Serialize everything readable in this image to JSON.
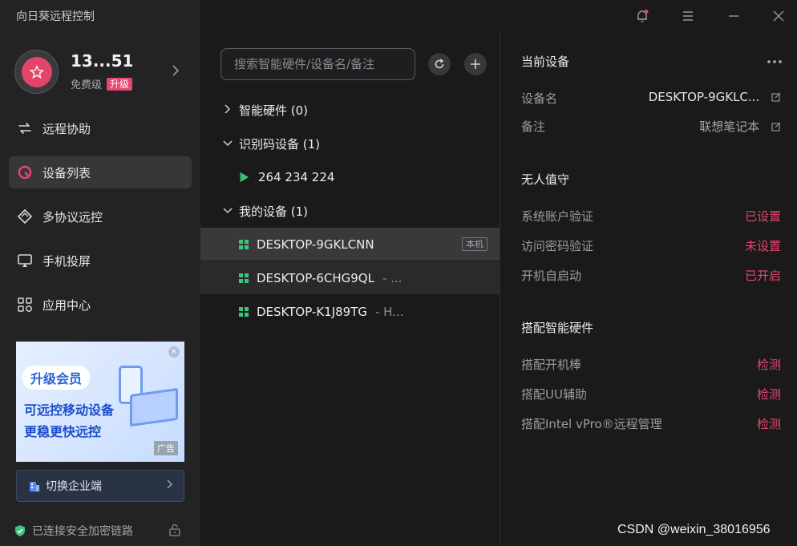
{
  "app": {
    "title": "向日葵远程控制"
  },
  "user": {
    "name": "13...51",
    "level": "免费级",
    "upgrade_label": "升级"
  },
  "nav": [
    {
      "label": "远程协助",
      "icon": "remote-assist-icon"
    },
    {
      "label": "设备列表",
      "icon": "device-list-icon",
      "active": true
    },
    {
      "label": "多协议远控",
      "icon": "multi-protocol-icon"
    },
    {
      "label": "手机投屏",
      "icon": "screen-cast-icon"
    },
    {
      "label": "应用中心",
      "icon": "app-center-icon"
    }
  ],
  "ad": {
    "pill": "升级会员",
    "line1": "可远控移动设备",
    "line2": "更稳更快远控",
    "tag": "广告"
  },
  "switch_button": {
    "label": "切换企业端"
  },
  "secure_status": "已连接安全加密链路",
  "search": {
    "placeholder": "搜索智能硬件/设备名/备注"
  },
  "groups": [
    {
      "label": "智能硬件 (0)",
      "expanded": false
    },
    {
      "label": "识别码设备 (1)",
      "expanded": true
    },
    {
      "label": "我的设备 (1)",
      "expanded": true
    }
  ],
  "code_device": {
    "code": "264 234 224"
  },
  "devices": [
    {
      "name": "DESKTOP-9GKLCNN",
      "note": "",
      "tag": "本机",
      "selected": true
    },
    {
      "name": "DESKTOP-6CHG9QL",
      "note": "- ...",
      "tag": ""
    },
    {
      "name": "DESKTOP-K1J89TG",
      "note": "- H...",
      "tag": ""
    }
  ],
  "current_device": {
    "title": "当前设备",
    "name_label": "设备名",
    "name_value": "DESKTOP-9GKLC...",
    "note_label": "备注",
    "note_value": "联想笔记本"
  },
  "unattended": {
    "title": "无人值守",
    "rows": [
      {
        "label": "系统账户验证",
        "value": "已设置"
      },
      {
        "label": "访问密码验证",
        "value": "未设置"
      },
      {
        "label": "开机自启动",
        "value": "已开启"
      }
    ]
  },
  "hardware": {
    "title": "搭配智能硬件",
    "rows": [
      {
        "label": "搭配开机棒",
        "value": "检测"
      },
      {
        "label": "搭配UU辅助",
        "value": "检测"
      },
      {
        "label": "搭配Intel vPro®远程管理",
        "value": "检测"
      }
    ]
  },
  "watermark": "CSDN @weixin_38016956",
  "colors": {
    "accent": "#e8456d",
    "sidebar_bg": "#232325",
    "panel_bg": "#1a1a1b",
    "green": "#3fc27b"
  }
}
